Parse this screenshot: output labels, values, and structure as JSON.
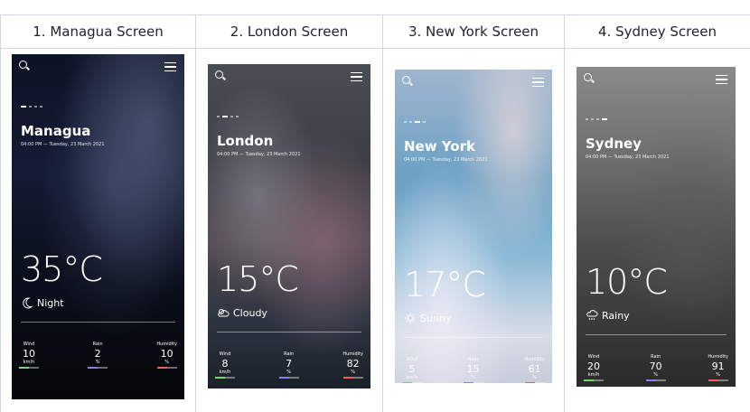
{
  "headers": [
    "1. Managua Screen",
    "2. London Screen",
    "3. New York Screen",
    "4. Sydney Screen"
  ],
  "screens": [
    {
      "city": "Managua",
      "date": "04:00 PM — Tuesday, 23 March 2021",
      "temp": "35°C",
      "condition": "Night",
      "condition_icon": "moon-icon",
      "wind": {
        "label": "Wind",
        "value": "10",
        "unit": "km/h"
      },
      "rain": {
        "label": "Rain",
        "value": "2",
        "unit": "%"
      },
      "humidity": {
        "label": "Humidity",
        "value": "10",
        "unit": "%"
      }
    },
    {
      "city": "London",
      "date": "04:00 PM — Tuesday, 23 March 2021",
      "temp": "15°C",
      "condition": "Cloudy",
      "condition_icon": "cloud-icon",
      "wind": {
        "label": "Wind",
        "value": "8",
        "unit": "km/h"
      },
      "rain": {
        "label": "Rain",
        "value": "7",
        "unit": "%"
      },
      "humidity": {
        "label": "Humidity",
        "value": "82",
        "unit": "%"
      }
    },
    {
      "city": "New York",
      "date": "04:00 PM — Tuesday, 23 March 2021",
      "temp": "17°C",
      "condition": "Sunny",
      "condition_icon": "sun-icon",
      "wind": {
        "label": "Wind",
        "value": "5",
        "unit": "km/h"
      },
      "rain": {
        "label": "Rain",
        "value": "15",
        "unit": "%"
      },
      "humidity": {
        "label": "Humidity",
        "value": "61",
        "unit": "%"
      }
    },
    {
      "city": "Sydney",
      "date": "04:00 PM — Tuesday, 23 March 2021",
      "temp": "10°C",
      "condition": "Rainy",
      "condition_icon": "rain-cloud-icon",
      "wind": {
        "label": "Wind",
        "value": "20",
        "unit": "km/h"
      },
      "rain": {
        "label": "Rain",
        "value": "70",
        "unit": "%"
      },
      "humidity": {
        "label": "Humidity",
        "value": "91",
        "unit": "%"
      }
    }
  ],
  "colors": {
    "wind_bar": "#6cdc6c",
    "rain_bar": "#8a7cff",
    "humidity_bar": "#ff5a5a"
  }
}
